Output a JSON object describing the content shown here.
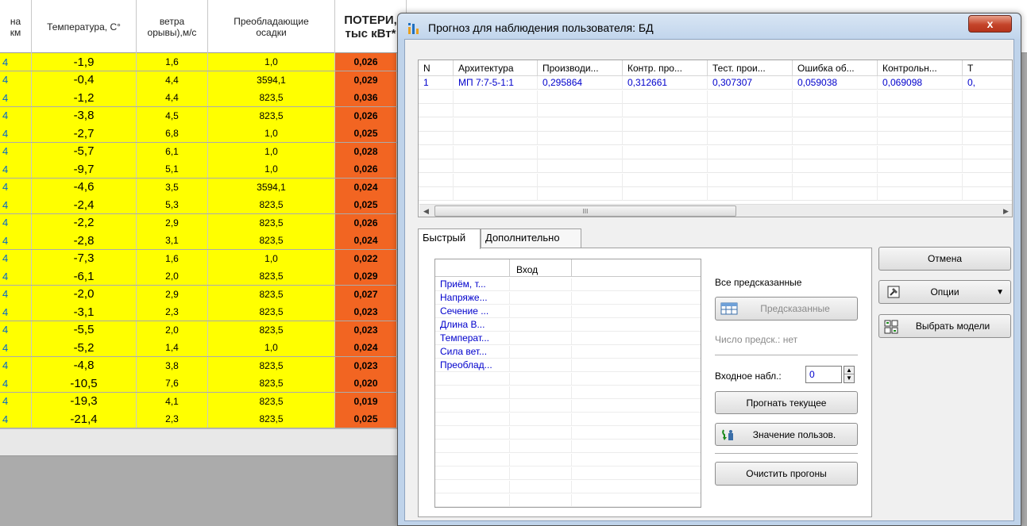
{
  "sheet": {
    "headers": [
      {
        "text": "на\nкм"
      },
      {
        "text": "Температура, С°"
      },
      {
        "text": "ветра\nорывы),м/с"
      },
      {
        "text": "Преобладающие\nосадки"
      },
      {
        "text": "ПОТЕРИ,\nтыс кВт*"
      }
    ],
    "row_prefix": "4",
    "rows": [
      [
        "-1,9",
        "1,6",
        "1,0",
        "0,026"
      ],
      [
        "-0,4",
        "4,4",
        "3594,1",
        "0,029"
      ],
      [
        "-1,2",
        "4,4",
        "823,5",
        "0,036"
      ],
      [
        "-3,8",
        "4,5",
        "823,5",
        "0,026"
      ],
      [
        "-2,7",
        "6,8",
        "1,0",
        "0,025"
      ],
      [
        "-5,7",
        "6,1",
        "1,0",
        "0,028"
      ],
      [
        "-9,7",
        "5,1",
        "1,0",
        "0,026"
      ],
      [
        "-4,6",
        "3,5",
        "3594,1",
        "0,024"
      ],
      [
        "-2,4",
        "5,3",
        "823,5",
        "0,025"
      ],
      [
        "-2,2",
        "2,9",
        "823,5",
        "0,026"
      ],
      [
        "-2,8",
        "3,1",
        "823,5",
        "0,024"
      ],
      [
        "-7,3",
        "1,6",
        "1,0",
        "0,022"
      ],
      [
        "-6,1",
        "2,0",
        "823,5",
        "0,029"
      ],
      [
        "-2,0",
        "2,9",
        "823,5",
        "0,027"
      ],
      [
        "-3,1",
        "2,3",
        "823,5",
        "0,023"
      ],
      [
        "-5,5",
        "2,0",
        "823,5",
        "0,023"
      ],
      [
        "-5,2",
        "1,4",
        "1,0",
        "0,024"
      ],
      [
        "-4,8",
        "3,8",
        "823,5",
        "0,023"
      ],
      [
        "-10,5",
        "7,6",
        "823,5",
        "0,020"
      ],
      [
        "-19,3",
        "4,1",
        "823,5",
        "0,019"
      ],
      [
        "-21,4",
        "2,3",
        "823,5",
        "0,025"
      ]
    ]
  },
  "dialog": {
    "title": "Прогноз для наблюдения пользователя: БД",
    "close_label": "x",
    "grid": {
      "columns": [
        "N",
        "Архитектура",
        "Производи...",
        "Контр. про...",
        "Тест. прои...",
        "Ошибка об...",
        "Контрольн...",
        "Т"
      ],
      "rows": [
        [
          "1",
          "МП 7:7-5-1:1",
          "0,295864",
          "0,312661",
          "0,307307",
          "0,059038",
          "0,069098",
          "0,"
        ]
      ],
      "scroll_thumb_glyph": "III",
      "scroll_left": "◀",
      "scroll_right": "▶"
    },
    "tabs": [
      "Быстрый",
      "Дополнительно"
    ],
    "input_list": {
      "header": "Вход",
      "items": [
        "Приём, т...",
        "Напряже...",
        "Сечение ...",
        "Длина В...",
        "Температ...",
        "Сила вет...",
        "Преоблад..."
      ]
    },
    "all_predicted_label": "Все предсказанные",
    "predicted_button": "Предсказанные",
    "pred_count_label": "Число предск.:",
    "pred_count_value": "нет",
    "input_obs_label": "Входное набл.:",
    "input_obs_value": "0",
    "run_current_button": "Прогнать текущее",
    "user_value_button": "Значение пользов.",
    "clear_runs_button": "Очистить прогоны",
    "cancel_button": "Отмена",
    "options_button": "Опции",
    "choose_models_button": "Выбрать модели"
  }
}
